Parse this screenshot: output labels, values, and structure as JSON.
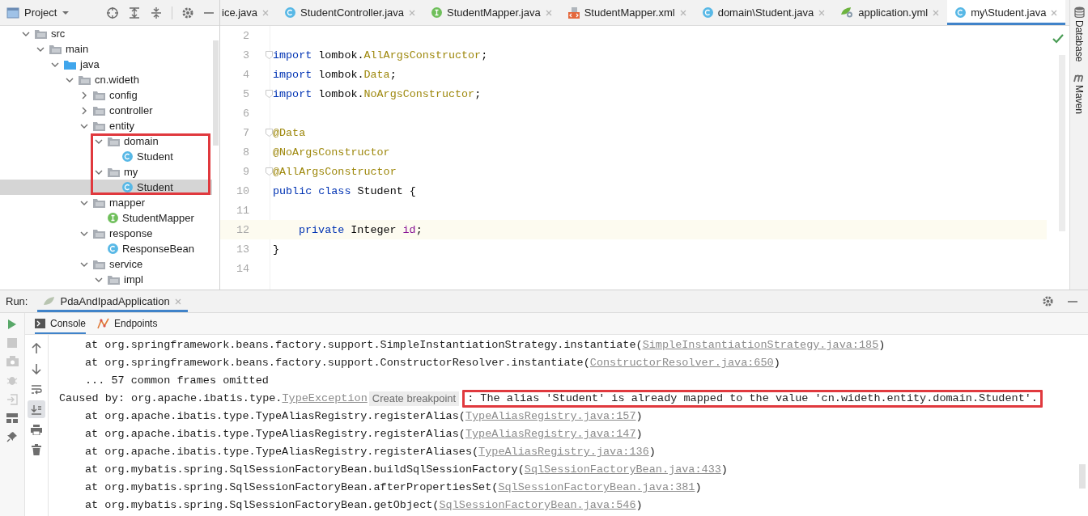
{
  "project_panel": {
    "title": "Project",
    "tree": [
      {
        "label": "src",
        "kind": "folder",
        "expanded": true,
        "selected": false,
        "highlighted": false,
        "children": [
          {
            "label": "main",
            "kind": "folder",
            "expanded": true,
            "selected": false,
            "highlighted": false,
            "children": [
              {
                "label": "java",
                "kind": "source-folder",
                "expanded": true,
                "selected": false,
                "highlighted": false,
                "children": [
                  {
                    "label": "cn.wideth",
                    "kind": "folder",
                    "expanded": true,
                    "selected": false,
                    "highlighted": false,
                    "children": [
                      {
                        "label": "config",
                        "kind": "folder",
                        "expanded": false,
                        "selected": false,
                        "highlighted": false
                      },
                      {
                        "label": "controller",
                        "kind": "folder",
                        "expanded": false,
                        "selected": false,
                        "highlighted": false
                      },
                      {
                        "label": "entity",
                        "kind": "folder",
                        "expanded": true,
                        "selected": false,
                        "highlighted": false,
                        "children": [
                          {
                            "label": "domain",
                            "kind": "folder",
                            "expanded": true,
                            "selected": false,
                            "highlighted": true,
                            "children": [
                              {
                                "label": "Student",
                                "kind": "class",
                                "selected": false,
                                "highlighted": true
                              }
                            ]
                          },
                          {
                            "label": "my",
                            "kind": "folder",
                            "expanded": true,
                            "selected": false,
                            "highlighted": true,
                            "children": [
                              {
                                "label": "Student",
                                "kind": "class",
                                "selected": true,
                                "highlighted": true
                              }
                            ]
                          }
                        ]
                      },
                      {
                        "label": "mapper",
                        "kind": "folder",
                        "expanded": true,
                        "selected": false,
                        "highlighted": false,
                        "children": [
                          {
                            "label": "StudentMapper",
                            "kind": "interface",
                            "selected": false,
                            "highlighted": false
                          }
                        ]
                      },
                      {
                        "label": "response",
                        "kind": "folder",
                        "expanded": true,
                        "selected": false,
                        "highlighted": false,
                        "children": [
                          {
                            "label": "ResponseBean",
                            "kind": "class",
                            "selected": false,
                            "highlighted": false
                          }
                        ]
                      },
                      {
                        "label": "service",
                        "kind": "folder",
                        "expanded": true,
                        "selected": false,
                        "highlighted": false,
                        "children": [
                          {
                            "label": "impl",
                            "kind": "folder",
                            "expanded": true,
                            "selected": false,
                            "highlighted": false
                          }
                        ]
                      }
                    ]
                  }
                ]
              }
            ]
          }
        ]
      }
    ]
  },
  "editor_tabs": [
    {
      "label": "ice.java",
      "kind": "none",
      "selected": false
    },
    {
      "label": "StudentController.java",
      "kind": "class",
      "selected": false
    },
    {
      "label": "StudentMapper.java",
      "kind": "interface",
      "selected": false
    },
    {
      "label": "StudentMapper.xml",
      "kind": "xml",
      "selected": false
    },
    {
      "label": "domain\\Student.java",
      "kind": "class",
      "selected": false
    },
    {
      "label": "application.yml",
      "kind": "yml",
      "selected": false
    },
    {
      "label": "my\\Student.java",
      "kind": "class",
      "selected": true
    }
  ],
  "code_lines": [
    {
      "number": "2",
      "current": false,
      "fold": false,
      "kind": "top"
    },
    {
      "number": "3",
      "current": false,
      "fold": true,
      "kind": "top",
      "tokens": [
        {
          "kind": "keyword",
          "text": "import"
        },
        {
          "kind": "plain",
          "text": " lombok."
        },
        {
          "kind": "annotation",
          "text": "AllArgsConstructor"
        },
        {
          "kind": "plain",
          "text": ";"
        }
      ]
    },
    {
      "number": "4",
      "current": false,
      "fold": false,
      "kind": "top",
      "tokens": [
        {
          "kind": "keyword",
          "text": "import"
        },
        {
          "kind": "plain",
          "text": " lombok."
        },
        {
          "kind": "annotation",
          "text": "Data"
        },
        {
          "kind": "plain",
          "text": ";"
        }
      ]
    },
    {
      "number": "5",
      "current": false,
      "fold": true,
      "kind": "top",
      "tokens": [
        {
          "kind": "keyword",
          "text": "import"
        },
        {
          "kind": "plain",
          "text": " lombok."
        },
        {
          "kind": "annotation",
          "text": "NoArgsConstructor"
        },
        {
          "kind": "plain",
          "text": ";"
        }
      ]
    },
    {
      "number": "6",
      "current": false,
      "fold": false,
      "kind": "top"
    },
    {
      "number": "7",
      "current": false,
      "fold": true,
      "kind": "top",
      "tokens": [
        {
          "kind": "annotation",
          "text": "@Data"
        }
      ]
    },
    {
      "number": "8",
      "current": false,
      "fold": false,
      "kind": "top",
      "tokens": [
        {
          "kind": "annotation",
          "text": "@NoArgsConstructor"
        }
      ]
    },
    {
      "number": "9",
      "current": false,
      "fold": true,
      "kind": "top",
      "tokens": [
        {
          "kind": "annotation",
          "text": "@AllArgsConstructor"
        }
      ]
    },
    {
      "number": "10",
      "current": false,
      "fold": false,
      "kind": "top",
      "tokens": [
        {
          "kind": "keyword",
          "text": "public class"
        },
        {
          "kind": "plain",
          "text": " Student {"
        }
      ]
    },
    {
      "number": "11",
      "current": false,
      "fold": false,
      "kind": "top"
    },
    {
      "number": "12",
      "current": true,
      "fold": false,
      "kind": "member",
      "tokens": [
        {
          "kind": "keyword",
          "text": "private"
        },
        {
          "kind": "plain",
          "text": " Integer "
        },
        {
          "kind": "field",
          "text": "id"
        },
        {
          "kind": "plain",
          "text": ";"
        }
      ]
    },
    {
      "number": "13",
      "current": false,
      "fold": false,
      "kind": "top",
      "tokens": [
        {
          "kind": "plain",
          "text": "}"
        }
      ]
    },
    {
      "number": "14",
      "current": false,
      "fold": false,
      "kind": "top"
    }
  ],
  "side_tools": [
    "Database",
    "Maven"
  ],
  "run_panel": {
    "label": "Run:",
    "tabs": [
      {
        "label": "PdaAndIpadApplication",
        "selected": true
      }
    ],
    "sub_tabs": [
      {
        "label": "Console",
        "kind": "console",
        "selected": true
      },
      {
        "label": "Endpoints",
        "kind": "endpoints",
        "selected": false
      }
    ],
    "console_toolbar": [
      {
        "kind": "up",
        "selected": false
      },
      {
        "kind": "down",
        "selected": false
      },
      {
        "kind": "wrap",
        "selected": false
      },
      {
        "kind": "scroll-end",
        "selected": true
      },
      {
        "kind": "print",
        "selected": false
      },
      {
        "kind": "trash",
        "selected": false
      }
    ],
    "console_lines": [
      {
        "kind": "frame",
        "segments": [
          {
            "kind": "text",
            "text": "at org.springframework.beans.factory.support.SimpleInstantiationStrategy.instantiate(",
            "highlighted": false
          },
          {
            "kind": "link",
            "text": "SimpleInstantiationStrategy.java:185",
            "highlighted": false
          },
          {
            "kind": "text",
            "text": ")",
            "highlighted": false
          }
        ]
      },
      {
        "kind": "frame",
        "segments": [
          {
            "kind": "text",
            "text": "at org.springframework.beans.factory.support.ConstructorResolver.instantiate(",
            "highlighted": false
          },
          {
            "kind": "link",
            "text": "ConstructorResolver.java:650",
            "highlighted": false
          },
          {
            "kind": "text",
            "text": ")",
            "highlighted": false
          }
        ]
      },
      {
        "kind": "frame",
        "segments": [
          {
            "kind": "text",
            "text": "... 57 common frames omitted",
            "highlighted": false
          }
        ]
      },
      {
        "kind": "cause",
        "segments": [
          {
            "kind": "text",
            "text": "Caused by: org.apache.ibatis.type.",
            "highlighted": false
          },
          {
            "kind": "link",
            "text": "TypeException",
            "highlighted": false
          },
          {
            "kind": "hint",
            "text": "Create breakpoint",
            "highlighted": false
          },
          {
            "kind": "text",
            "text": ": The alias 'Student' is already mapped to the value 'cn.wideth.entity.domain.Student'.",
            "highlighted": true
          }
        ]
      },
      {
        "kind": "frame",
        "segments": [
          {
            "kind": "text",
            "text": "at org.apache.ibatis.type.TypeAliasRegistry.registerAlias(",
            "highlighted": false
          },
          {
            "kind": "link",
            "text": "TypeAliasRegistry.java:157",
            "highlighted": false
          },
          {
            "kind": "text",
            "text": ")",
            "highlighted": false
          }
        ]
      },
      {
        "kind": "frame",
        "segments": [
          {
            "kind": "text",
            "text": "at org.apache.ibatis.type.TypeAliasRegistry.registerAlias(",
            "highlighted": false
          },
          {
            "kind": "link",
            "text": "TypeAliasRegistry.java:147",
            "highlighted": false
          },
          {
            "kind": "text",
            "text": ")",
            "highlighted": false
          }
        ]
      },
      {
        "kind": "frame",
        "segments": [
          {
            "kind": "text",
            "text": "at org.apache.ibatis.type.TypeAliasRegistry.registerAliases(",
            "highlighted": false
          },
          {
            "kind": "link",
            "text": "TypeAliasRegistry.java:136",
            "highlighted": false
          },
          {
            "kind": "text",
            "text": ")",
            "highlighted": false
          }
        ]
      },
      {
        "kind": "frame",
        "segments": [
          {
            "kind": "text",
            "text": "at org.mybatis.spring.SqlSessionFactoryBean.buildSqlSessionFactory(",
            "highlighted": false
          },
          {
            "kind": "link",
            "text": "SqlSessionFactoryBean.java:433",
            "highlighted": false
          },
          {
            "kind": "text",
            "text": ")",
            "highlighted": false
          }
        ]
      },
      {
        "kind": "frame",
        "segments": [
          {
            "kind": "text",
            "text": "at org.mybatis.spring.SqlSessionFactoryBean.afterPropertiesSet(",
            "highlighted": false
          },
          {
            "kind": "link",
            "text": "SqlSessionFactoryBean.java:381",
            "highlighted": false
          },
          {
            "kind": "text",
            "text": ")",
            "highlighted": false
          }
        ]
      },
      {
        "kind": "frame",
        "segments": [
          {
            "kind": "text",
            "text": "at org.mybatis.spring.SqlSessionFactoryBean.getObject(",
            "highlighted": false
          },
          {
            "kind": "link",
            "text": "SqlSessionFactoryBean.java:546",
            "highlighted": false
          },
          {
            "kind": "text",
            "text": ")",
            "highlighted": false
          }
        ]
      }
    ]
  }
}
